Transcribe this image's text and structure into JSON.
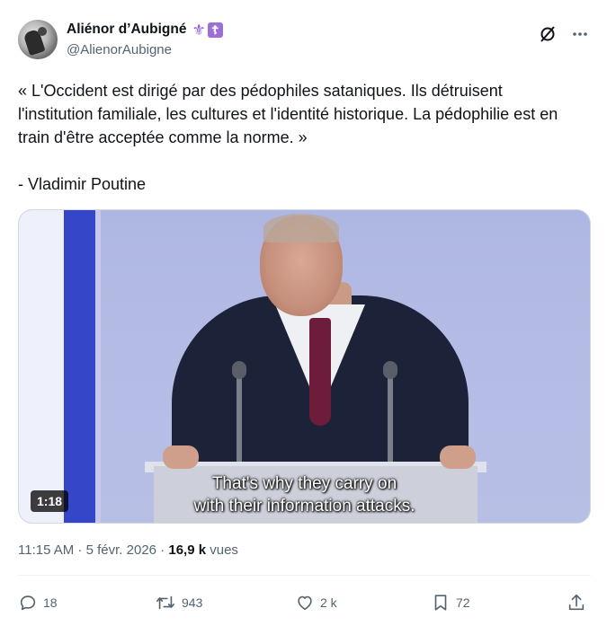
{
  "author": {
    "display_name": "Aliénor d’Aubigné",
    "handle": "@AlienorAubigne",
    "badge_fleur": "⚜",
    "badge_cross": "☦"
  },
  "tweet": {
    "text": "« L'Occident est dirigé par des pédophiles sataniques. Ils détruisent l'institution familiale, les cultures et l'identité historique. La pédophilie est en train d'être acceptée comme la norme. »\n\n- Vladimir Poutine"
  },
  "media": {
    "subtitle_line1": "That's why they carry on",
    "subtitle_line2": "with their information attacks.",
    "duration": "1:18"
  },
  "meta": {
    "time": "11:15 AM",
    "separator": " · ",
    "date": "5 févr. 2026",
    "views_count": "16,9 k",
    "views_label": " vues"
  },
  "actions": {
    "replies": "18",
    "reposts": "943",
    "likes": "2 k",
    "bookmarks": "72"
  },
  "icons": {
    "grok": "grok-icon",
    "more": "more-icon",
    "reply": "reply-icon",
    "repost": "repost-icon",
    "like": "heart-icon",
    "bookmark": "bookmark-icon",
    "share": "share-icon"
  },
  "colors": {
    "text": "#0f1419",
    "secondary": "#536471",
    "badge_purple": "#9b6fd6"
  }
}
